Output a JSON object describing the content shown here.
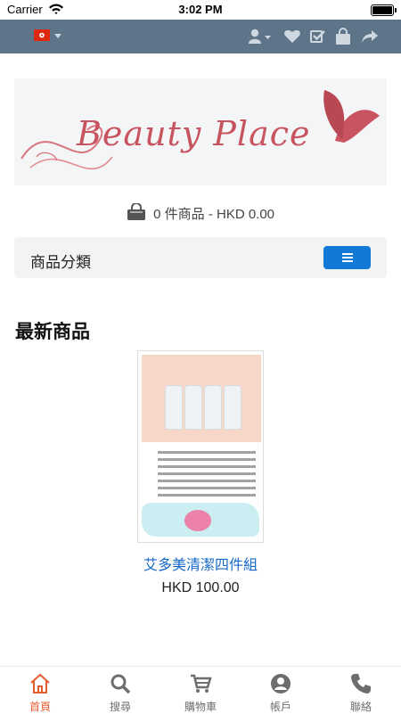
{
  "status_bar": {
    "carrier": "Carrier",
    "time": "3:02 PM"
  },
  "top_nav": {
    "language_flag": "hong-kong-flag-icon",
    "icons": [
      "user-icon",
      "heart-icon",
      "check-square-icon",
      "bag-icon",
      "share-icon"
    ]
  },
  "logo": {
    "text": "Beauty Place"
  },
  "cart": {
    "summary": "0 件商品 - HKD 0.00"
  },
  "category": {
    "title": "商品分類"
  },
  "latest": {
    "title": "最新商品",
    "products": [
      {
        "name": "艾多美清潔四件組",
        "price": "HKD 100.00"
      }
    ]
  },
  "tab_bar": {
    "tabs": [
      {
        "label": "首頁",
        "icon": "home-icon",
        "active": true
      },
      {
        "label": "搜尋",
        "icon": "search-icon",
        "active": false
      },
      {
        "label": "購物車",
        "icon": "cart-icon",
        "active": false
      },
      {
        "label": "帳戶",
        "icon": "account-icon",
        "active": false
      },
      {
        "label": "聯絡",
        "icon": "phone-icon",
        "active": false
      }
    ]
  },
  "colors": {
    "top_nav": "#5e7489",
    "menu_button": "#1279d6",
    "active_tab": "#e45d2f",
    "product_link": "#1367c8"
  }
}
